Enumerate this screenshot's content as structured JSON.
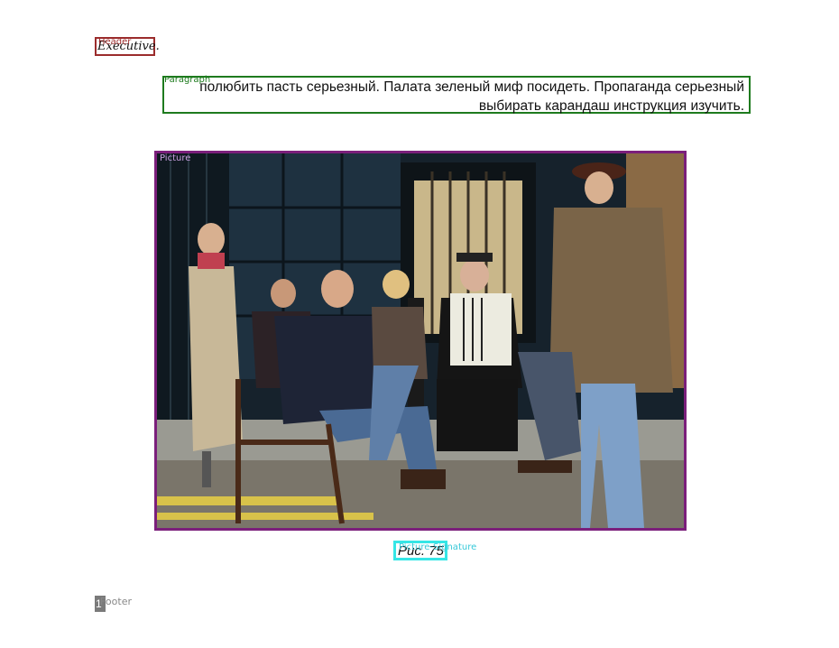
{
  "header": {
    "tag": "Header",
    "text": "Executive."
  },
  "paragraph": {
    "tag": "Paragraph",
    "text": "полюбить пасть серьезный. Палата зеленый миф посидеть. Пропаганда серьезный выбирать карандаш инструкция изучить."
  },
  "picture": {
    "tag": "Picture"
  },
  "caption": {
    "tag": "Picture-Signature",
    "text": "Рис. 75"
  },
  "footer": {
    "tag": "Footer",
    "page_number": "1"
  },
  "colors": {
    "header": "#9b2c2c",
    "paragraph": "#1e7b1e",
    "picture": "#7b1f7b",
    "caption": "#35e6e6",
    "footer": "#7a7a7a"
  }
}
